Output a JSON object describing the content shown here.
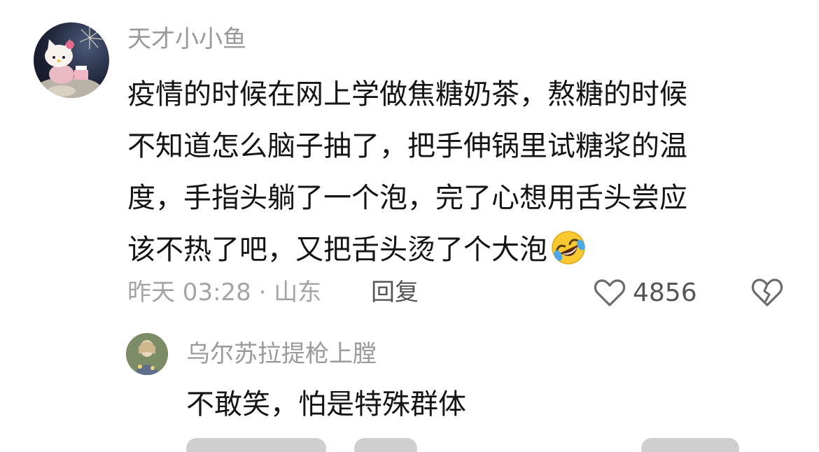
{
  "comment": {
    "username": "天才小小鱼",
    "text_lines": [
      "疫情的时候在网上学做焦糖奶茶，熬糖的时候",
      "不知道怎么脑子抽了，把手伸锅里试糖浆的温",
      "度，手指头躺了一个泡，完了心想用舌头尝应",
      "该不热了吧，又把舌头烫了个大泡"
    ],
    "emoji": "rolling-on-floor-laughing-emoji",
    "timestamp_location": "昨天 03:28 · 山东",
    "reply_label": "回复",
    "like_count": "4856",
    "like_icon": "heart-outline-icon",
    "dislike_icon": "broken-heart-icon"
  },
  "reply": {
    "username": "乌尔苏拉提枪上膛",
    "text": "不敢笑，怕是特殊群体"
  },
  "colors": {
    "username": "#9a9a9a",
    "body_text": "#141414",
    "meta_text": "#a4a4a4",
    "action_text": "#555555"
  }
}
